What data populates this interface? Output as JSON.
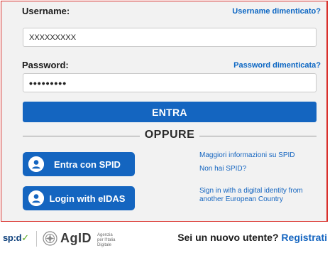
{
  "login": {
    "username_label": "Username:",
    "username_forgot_link": "Username dimenticato?",
    "username_value": "XXXXXXXXX",
    "password_label": "Password:",
    "password_forgot_link": "Password dimenticata?",
    "password_value": "•••••••••",
    "submit_label": "ENTRA"
  },
  "divider": {
    "text": "OPPURE"
  },
  "alt_login": {
    "spid_button": "Entra con SPID",
    "spid_more_info": "Maggiori informazioni su SPID",
    "spid_no_account": "Non hai SPID?",
    "eidas_button": "Login with eIDAS",
    "eidas_info": "Sign in with a digital identity from another European Country"
  },
  "footer": {
    "spid_logo_text": "sp:d",
    "spid_logo_check": "✓",
    "agid_text": "AgID",
    "agid_subtitle": "Agenzia per l'Italia Digitale",
    "new_user_prompt": "Sei un nuovo utente?",
    "register_link": "Registrati"
  },
  "colors": {
    "primary": "#1465c0",
    "frame_border": "#d9302b",
    "panel_bg": "#f2f2f2"
  },
  "icons": {
    "spid_button_icon": "user-icon",
    "eidas_button_icon": "user-icon",
    "agid_logo": "agid-emblem-icon"
  }
}
